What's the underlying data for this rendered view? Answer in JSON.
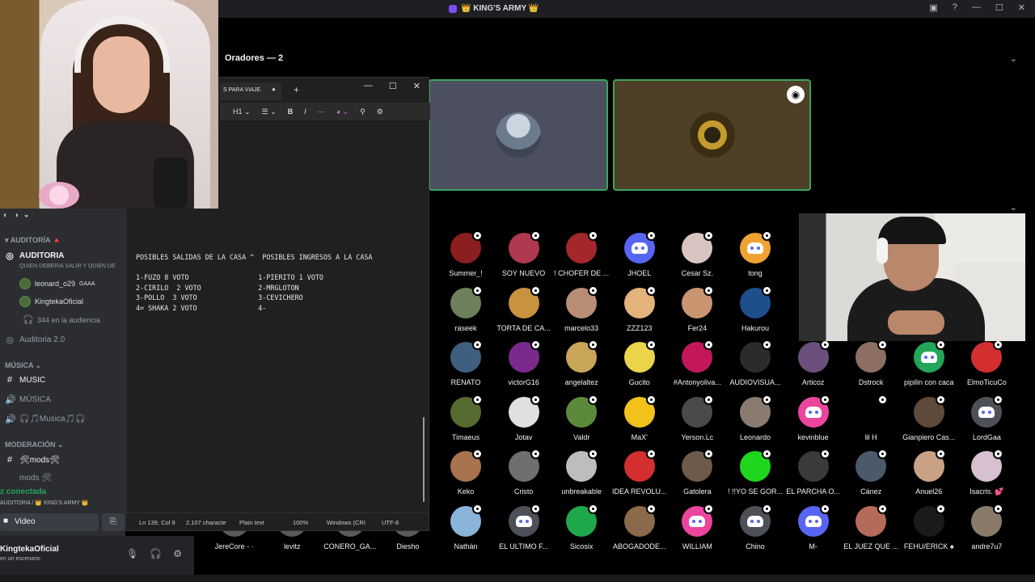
{
  "titlebar": {
    "server_name": "👑 KING'S ARMY 👑"
  },
  "stage": {
    "speakers_header": "Oradores — 2"
  },
  "audience": [
    {
      "name": "Summer_!",
      "type": "img",
      "color": "#8b1e1e",
      "col": 0,
      "row": 0
    },
    {
      "name": "SOY NUEVO",
      "type": "img",
      "color": "#b0384f",
      "col": 1,
      "row": 0
    },
    {
      "name": "! CHOFER DE ...",
      "type": "img",
      "color": "#a3272b",
      "col": 2,
      "row": 0
    },
    {
      "name": "JHOEL",
      "type": "discord",
      "color": "#5865f2",
      "col": 3,
      "row": 0
    },
    {
      "name": "Cesar Sz.",
      "type": "img",
      "color": "#d9c4c4",
      "col": 4,
      "row": 0
    },
    {
      "name": "tong",
      "type": "discord",
      "color": "#f0a233",
      "col": 5,
      "row": 0
    },
    {
      "name": "raseek",
      "type": "img",
      "color": "#6e7f5b",
      "col": 0,
      "row": 1
    },
    {
      "name": "TORTA DE CA...",
      "type": "img",
      "color": "#c8923e",
      "col": 1,
      "row": 1
    },
    {
      "name": "marcelo33",
      "type": "img",
      "color": "#b78e75",
      "col": 2,
      "row": 1
    },
    {
      "name": "ZZZ123",
      "type": "img",
      "color": "#e4b27b",
      "col": 3,
      "row": 1
    },
    {
      "name": "Fer24",
      "type": "img",
      "color": "#c89570",
      "col": 4,
      "row": 1
    },
    {
      "name": "Hakurou",
      "type": "img",
      "color": "#1e4e8c",
      "col": 5,
      "row": 1
    },
    {
      "name": "RENATO",
      "type": "img",
      "color": "#3f5f7e",
      "col": 0,
      "row": 2
    },
    {
      "name": "victorG16",
      "type": "img",
      "color": "#7a2a8c",
      "col": 1,
      "row": 2
    },
    {
      "name": "angelaltez",
      "type": "img",
      "color": "#c9a55a",
      "col": 2,
      "row": 2
    },
    {
      "name": "Gucito",
      "type": "img",
      "color": "#e9d44a",
      "col": 3,
      "row": 2
    },
    {
      "name": "#Antonyoliva...",
      "type": "img",
      "color": "#c2185b",
      "col": 4,
      "row": 2
    },
    {
      "name": "AUDIOVISUA...",
      "type": "img",
      "color": "#2b2b2b",
      "col": 5,
      "row": 2
    },
    {
      "name": "Articoz",
      "type": "img",
      "color": "#6b4f7c",
      "col": 6,
      "row": 2
    },
    {
      "name": "Dstrock",
      "type": "img",
      "color": "#8d6e63",
      "col": 7,
      "row": 2
    },
    {
      "name": "pipilin con caca",
      "type": "discord",
      "color": "#23a55a",
      "col": 8,
      "row": 2
    },
    {
      "name": "ElmoTicuCo",
      "type": "img",
      "color": "#d32f2f",
      "col": 9,
      "row": 2
    },
    {
      "name": "Timaeus",
      "type": "img",
      "color": "#556b2f",
      "col": 0,
      "row": 3
    },
    {
      "name": "Jotav",
      "type": "img",
      "color": "#e0e0e0",
      "col": 1,
      "row": 3
    },
    {
      "name": "Valdr",
      "type": "img",
      "color": "#5d8a3a",
      "col": 2,
      "row": 3
    },
    {
      "name": "MaX'",
      "type": "img",
      "color": "#f2c21b",
      "col": 3,
      "row": 3
    },
    {
      "name": "Yerson.Lc",
      "type": "img",
      "color": "#4a4a4a",
      "col": 4,
      "row": 3
    },
    {
      "name": "Leonardo",
      "type": "img",
      "color": "#8a7a70",
      "col": 5,
      "row": 3
    },
    {
      "name": "kevinblue",
      "type": "discord",
      "color": "#eb459e",
      "col": 6,
      "row": 3
    },
    {
      "name": "lil H",
      "type": "img",
      "color": "#000000",
      "col": 7,
      "row": 3
    },
    {
      "name": "Gianpiero Cas...",
      "type": "img",
      "color": "#5e4a3a",
      "col": 8,
      "row": 3
    },
    {
      "name": "LordGaa",
      "type": "discord",
      "color": "#4e5058",
      "col": 9,
      "row": 3
    },
    {
      "name": "Keko",
      "type": "img",
      "color": "#a8734f",
      "col": 0,
      "row": 4
    },
    {
      "name": "Cristo",
      "type": "img",
      "color": "#6f6f6f",
      "col": 1,
      "row": 4
    },
    {
      "name": "unbreakable",
      "type": "img",
      "color": "#bdbdbd",
      "col": 2,
      "row": 4
    },
    {
      "name": "IDEA REVOLU...",
      "type": "img",
      "color": "#d32f2f",
      "col": 3,
      "row": 4
    },
    {
      "name": "Gatolera",
      "type": "img",
      "color": "#6d5a4a",
      "col": 4,
      "row": 4
    },
    {
      "name": "! !!YO SE GOR...",
      "type": "img",
      "color": "#1fd61f",
      "col": 5,
      "row": 4
    },
    {
      "name": "EL PARCHA O...",
      "type": "img",
      "color": "#3a3a3a",
      "col": 6,
      "row": 4
    },
    {
      "name": "Cánez",
      "type": "img",
      "color": "#4a5a6a",
      "col": 7,
      "row": 4
    },
    {
      "name": "Anuel26",
      "type": "img",
      "color": "#c9a184",
      "col": 8,
      "row": 4
    },
    {
      "name": "Isacris. 💕",
      "type": "img",
      "color": "#d7c0d0",
      "col": 9,
      "row": 4
    },
    {
      "name": "Nathán",
      "type": "img",
      "color": "#8ab4d8",
      "col": 0,
      "row": 5
    },
    {
      "name": "EL ULTIMO F...",
      "type": "discord",
      "color": "#4e5058",
      "col": 1,
      "row": 5
    },
    {
      "name": "Sicosix",
      "type": "img",
      "color": "#1ea84a",
      "col": 2,
      "row": 5
    },
    {
      "name": "ABOGADODE...",
      "type": "img",
      "color": "#8a6a4a",
      "col": 3,
      "row": 5
    },
    {
      "name": "WILLIAM",
      "type": "discord",
      "color": "#eb459e",
      "col": 4,
      "row": 5
    },
    {
      "name": "Chino",
      "type": "discord",
      "color": "#4e5058",
      "col": 5,
      "row": 5
    },
    {
      "name": "M-",
      "type": "discord",
      "color": "#5865f2",
      "col": 6,
      "row": 5
    },
    {
      "name": "EL JUEZ QUE ...",
      "type": "img",
      "color": "#b56a5a",
      "col": 7,
      "row": 5
    },
    {
      "name": "FEHU/ERICK ♠",
      "type": "img",
      "color": "#1a1a1a",
      "col": 8,
      "row": 5
    },
    {
      "name": "andre7u7",
      "type": "img",
      "color": "#8a7a6a",
      "col": 9,
      "row": 5
    }
  ],
  "audience_partial": [
    {
      "name": "JereCore - ·",
      "col": -4
    },
    {
      "name": "levitz",
      "col": -3
    },
    {
      "name": "CONERO_GA...",
      "col": -2
    },
    {
      "name": "Diesho",
      "col": -1
    }
  ],
  "sidebar": {
    "cat_auditoria": "AUDITORÍA",
    "ch_auditoria": "AUDITORIA",
    "ch_auditoria_topic": "QUIEN DEBERIA SALIR Y QUIEN DE",
    "user1": "leonard_o29",
    "user1_tag": "GAAA",
    "user2": "KingtekaOficial",
    "audience_count": "344 en la audiencia",
    "ch_auditoria2": "Auditoria 2.0",
    "cat_musica": "MÚSICA",
    "ch_music": "MUSIC",
    "ch_musica": "MÚSICA",
    "ch_musica2": "🎧🎵Musica🎵🎧",
    "cat_moderacion": "MODERACIÓN",
    "ch_mods": "🛠mods🛠",
    "ch_mods2": "mods 🛠",
    "voice_status": "z conectada",
    "voice_location": "AUDITORIA / 👑 KING'S ARMY 👑",
    "video_label": "Video",
    "username": "KingtekaOficial",
    "user_status": "en un escenario"
  },
  "notepad": {
    "tab_title": "S PARA VIAJE.",
    "heading_label": "H1",
    "bold_label": "B",
    "italic_label": "I",
    "content": "POSIBLES SALIDAS DE LA CASA ^  POSIBLES INGRESOS A LA CASA\n\n1-FUZO 8 VOTO                 1-PIERITO 1 VOTO\n2-CIRILO  2 VOTO              2-MRGLOTON\n3-POLLO  3 VOTO               3-CEVICHERO\n4= SHAKA 2 VOTO               4-",
    "status_position": "Ln 139, Col 9",
    "status_chars": "2,107 characte",
    "status_format": "Plain text",
    "status_zoom": "100%",
    "status_lineend": "Windows (CRI",
    "status_encoding": "UTF-8"
  }
}
